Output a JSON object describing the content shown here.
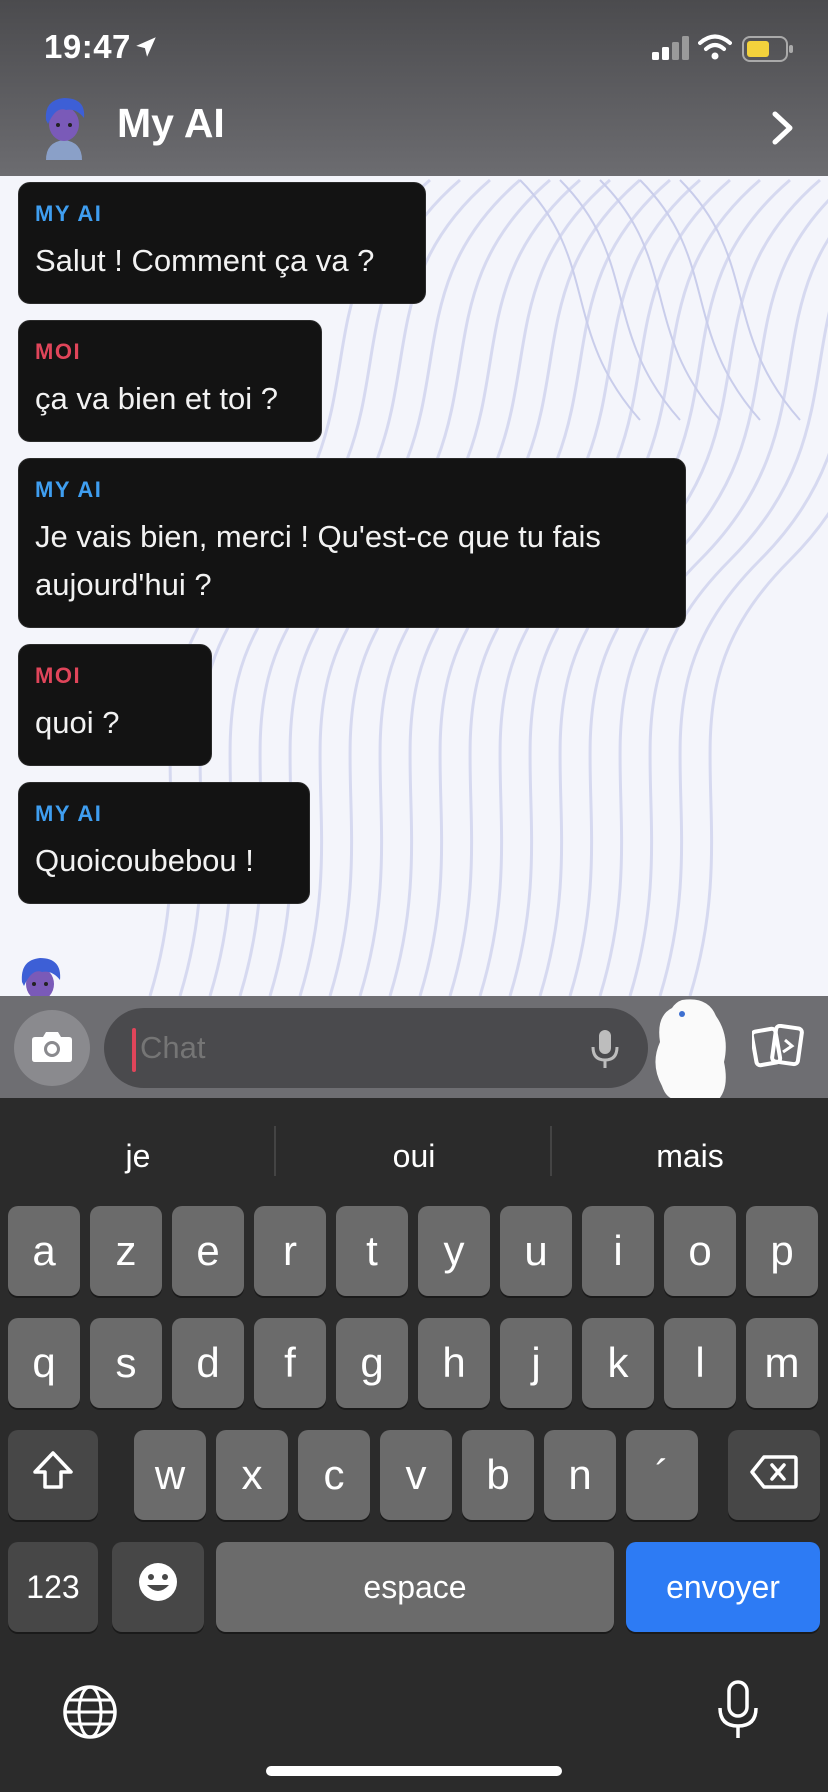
{
  "status_bar": {
    "time": "19:47"
  },
  "header": {
    "title": "My AI"
  },
  "messages": [
    {
      "sender": "MY AI",
      "text": "Salut ! Comment ça va ?"
    },
    {
      "sender": "MOI",
      "text": "ça va bien et toi ?"
    },
    {
      "sender": "MY AI",
      "text": "Je vais bien, merci ! Qu'est-ce que tu fais aujourd'hui ?"
    },
    {
      "sender": "MOI",
      "text": "quoi ?"
    },
    {
      "sender": "MY AI",
      "text": "Quoicoubebou !"
    }
  ],
  "input": {
    "placeholder": "Chat"
  },
  "keyboard": {
    "suggestions": [
      "je",
      "oui",
      "mais"
    ],
    "row1": [
      "a",
      "z",
      "e",
      "r",
      "t",
      "y",
      "u",
      "i",
      "o",
      "p"
    ],
    "row2": [
      "q",
      "s",
      "d",
      "f",
      "g",
      "h",
      "j",
      "k",
      "l",
      "m"
    ],
    "row3": [
      "w",
      "x",
      "c",
      "v",
      "b",
      "n",
      "´"
    ],
    "numbers_label": "123",
    "space_label": "espace",
    "send_label": "envoyer"
  },
  "colors": {
    "ai_sender": "#3f9ef0",
    "me_sender": "#e0455a",
    "send_key": "#2d7bf4"
  },
  "icons": [
    "location-arrow-icon",
    "signal-icon",
    "wifi-icon",
    "battery-icon",
    "chevron-right-icon",
    "camera-icon",
    "microphone-icon",
    "cards-icon",
    "shift-icon",
    "backspace-icon",
    "emoji-icon",
    "globe-icon"
  ]
}
